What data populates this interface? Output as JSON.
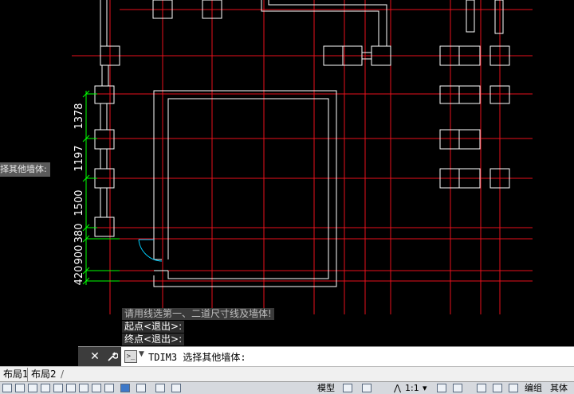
{
  "drawing": {
    "dimensions": [
      "1378",
      "1197",
      "1500",
      "380",
      "900",
      "420"
    ],
    "dim_values_note_free": true
  },
  "cursor_tip": "择其他墙体:",
  "history": [
    "请用线选第一、二道尺寸线及墙体!",
    "起点<退出>:",
    "终点<退出>:"
  ],
  "command": {
    "close_label": "✕",
    "prompt_icon": ">_",
    "current": "TDIM3 选择其他墙体:"
  },
  "tabs": [
    "布局1",
    "布局2"
  ],
  "status": {
    "model_label": "模型",
    "scale": "1:1",
    "right_labels": [
      "编组",
      "其体"
    ]
  },
  "colors": {
    "axis_red": "#e8111b",
    "wall_white": "#ffffff",
    "dim_green": "#00ff00"
  }
}
